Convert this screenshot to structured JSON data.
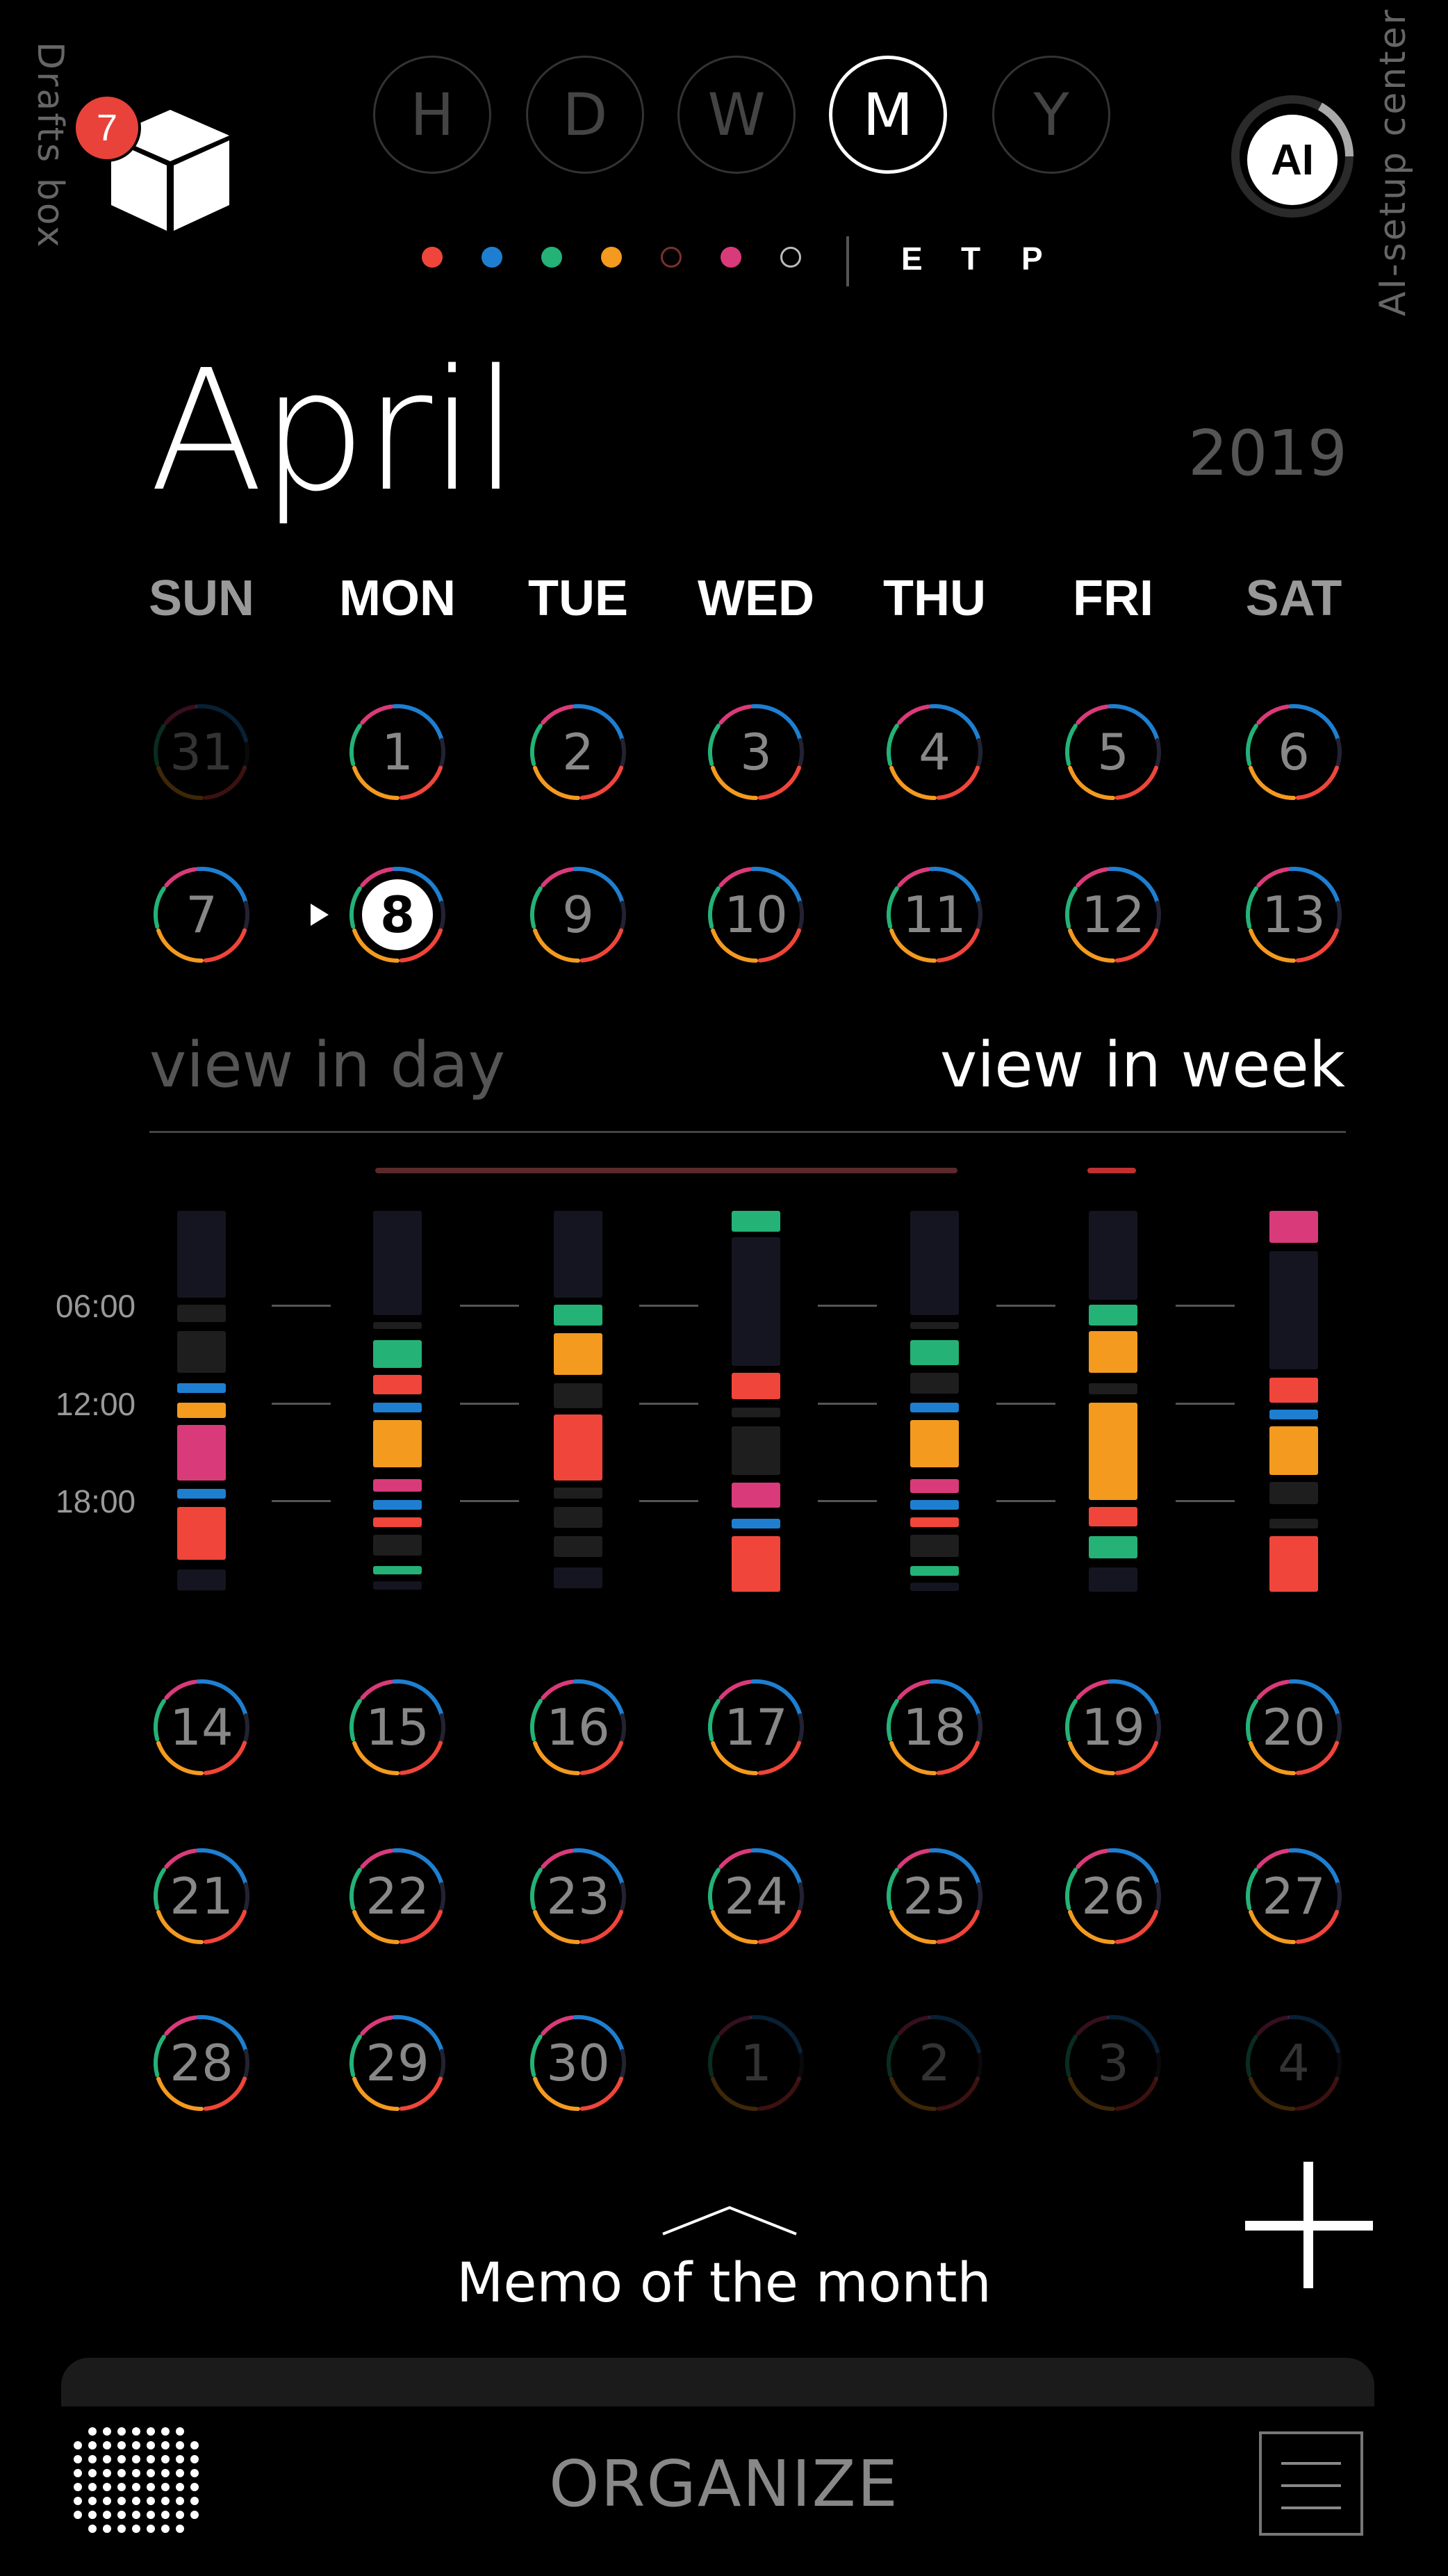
{
  "header": {
    "drafts_label": "Drafts box",
    "drafts_badge": "7",
    "ai_label": "AI",
    "ai_setup_label": "AI-setup center",
    "periods": [
      "H",
      "D",
      "W",
      "M",
      "Y"
    ],
    "active_period": "M",
    "filter_dots": [
      {
        "color": "#f0453a",
        "filled": true
      },
      {
        "color": "#1e7fd1",
        "filled": true
      },
      {
        "color": "#24b277",
        "filled": true
      },
      {
        "color": "#f39a1f",
        "filled": true
      },
      {
        "color": "#7a3030",
        "filled": false
      },
      {
        "color": "#d93a7a",
        "filled": true
      },
      {
        "color": "#bbbbbb",
        "filled": false
      }
    ],
    "etp": [
      "E",
      "T",
      "P"
    ]
  },
  "calendar": {
    "month": "April",
    "year": "2019",
    "weekdays": [
      "SUN",
      "MON",
      "TUE",
      "WED",
      "THU",
      "FRI",
      "SAT"
    ],
    "week1": [
      "31",
      "1",
      "2",
      "3",
      "4",
      "5",
      "6"
    ],
    "week2": [
      "7",
      "8",
      "9",
      "10",
      "11",
      "12",
      "13"
    ],
    "week3": [
      "14",
      "15",
      "16",
      "17",
      "18",
      "19",
      "20"
    ],
    "week4": [
      "21",
      "22",
      "23",
      "24",
      "25",
      "26",
      "27"
    ],
    "week5": [
      "28",
      "29",
      "30",
      "1",
      "2",
      "3",
      "4"
    ],
    "today": "8",
    "dim_days": [
      "31",
      "1",
      "2",
      "3",
      "4"
    ]
  },
  "week_view": {
    "view_in_day": "view in day",
    "view_in_week": "view in week",
    "times": [
      "06:00",
      "12:00",
      "18:00"
    ]
  },
  "footer": {
    "memo_label": "Memo of the month",
    "organize_label": "ORGANIZE"
  },
  "colors": {
    "red": "#f0453a",
    "blue": "#1e7fd1",
    "green": "#24b277",
    "orange": "#f39a1f",
    "pink": "#d93a7a",
    "dark": "#151522",
    "gray": "#1e1e1e"
  }
}
